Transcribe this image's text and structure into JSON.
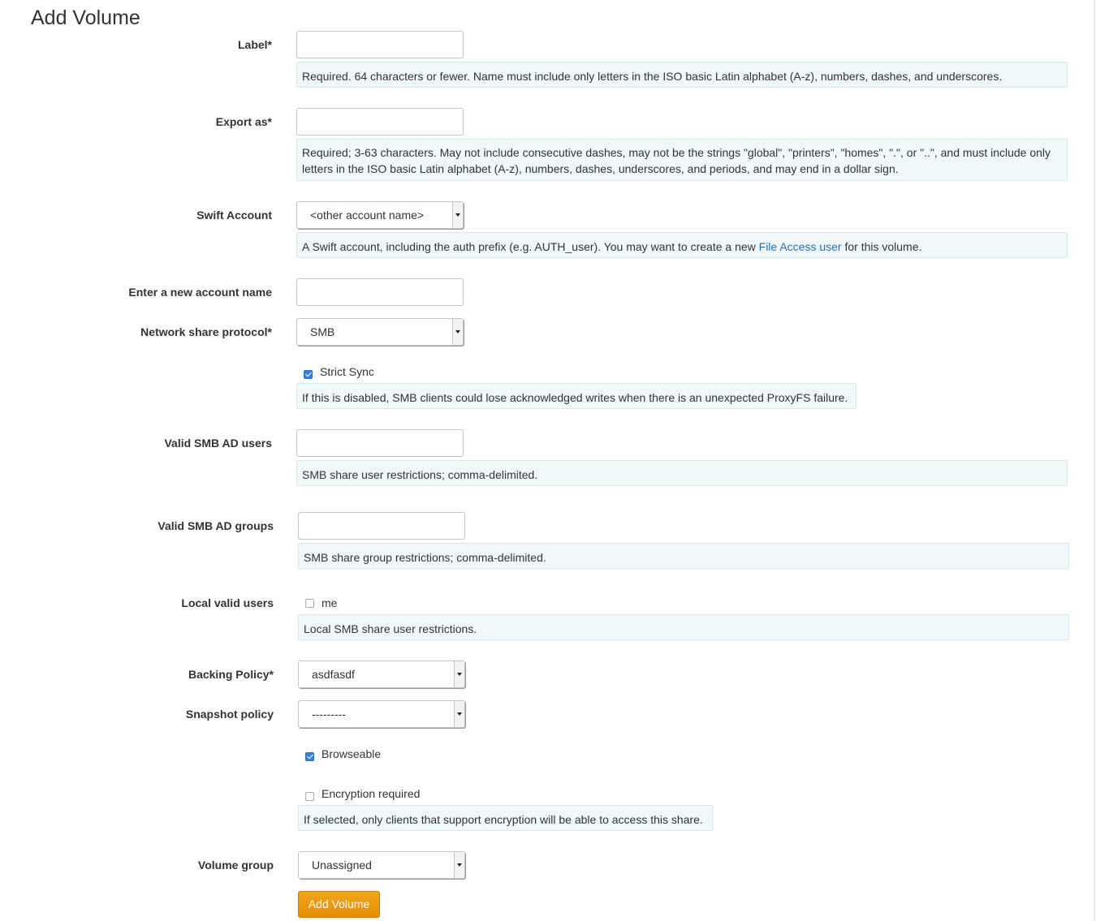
{
  "page": {
    "title": "Add Volume"
  },
  "form": {
    "label": {
      "label": "Label*",
      "value": "",
      "help": "Required. 64 characters or fewer. Name must include only letters in the ISO basic Latin alphabet (A-z), numbers, dashes, and underscores."
    },
    "export_as": {
      "label": "Export as*",
      "value": "",
      "help": "Required; 3-63 characters. May not include consecutive dashes, may not be the strings \"global\", \"printers\", \"homes\", \".\", or \"..\", and must include only letters in the ISO basic Latin alphabet (A-z), numbers, dashes, underscores, and periods, and may end in a dollar sign."
    },
    "swift_account": {
      "label": "Swift Account",
      "selected": "<other account name>",
      "help_before": "A Swift account, including the auth prefix (e.g. AUTH_user). You may want to create a new ",
      "help_link": "File Access user",
      "help_after": " for this volume."
    },
    "new_account_name": {
      "label": "Enter a new account name",
      "value": ""
    },
    "network_share_protocol": {
      "label": "Network share protocol*",
      "selected": "SMB"
    },
    "strict_sync": {
      "label": "Strict Sync",
      "checked": true,
      "help": "If this is disabled, SMB clients could lose acknowledged writes when there is an unexpected ProxyFS failure."
    },
    "valid_smb_ad_users": {
      "label": "Valid SMB AD users",
      "value": "",
      "help": "SMB share user restrictions; comma-delimited."
    },
    "valid_smb_ad_groups": {
      "label": "Valid SMB AD groups",
      "value": "",
      "help": "SMB share group restrictions; comma-delimited."
    },
    "local_valid_users": {
      "label": "Local valid users",
      "option": "me",
      "checked": false,
      "help": "Local SMB share user restrictions."
    },
    "backing_policy": {
      "label": "Backing Policy*",
      "selected": "asdfasdf"
    },
    "snapshot_policy": {
      "label": "Snapshot policy",
      "selected": "---------"
    },
    "browseable": {
      "label": "Browseable",
      "checked": true
    },
    "encryption_required": {
      "label": "Encryption required",
      "checked": false,
      "help": "If selected, only clients that support encryption will be able to access this share."
    },
    "volume_group": {
      "label": "Volume group",
      "selected": "Unassigned"
    },
    "submit": {
      "label": "Add Volume"
    }
  },
  "colors": {
    "accent_button": "#f0a01a",
    "help_bg": "#f1f8f9",
    "link": "#2a6fb4",
    "checkbox_checked": "#3a7fd6"
  }
}
